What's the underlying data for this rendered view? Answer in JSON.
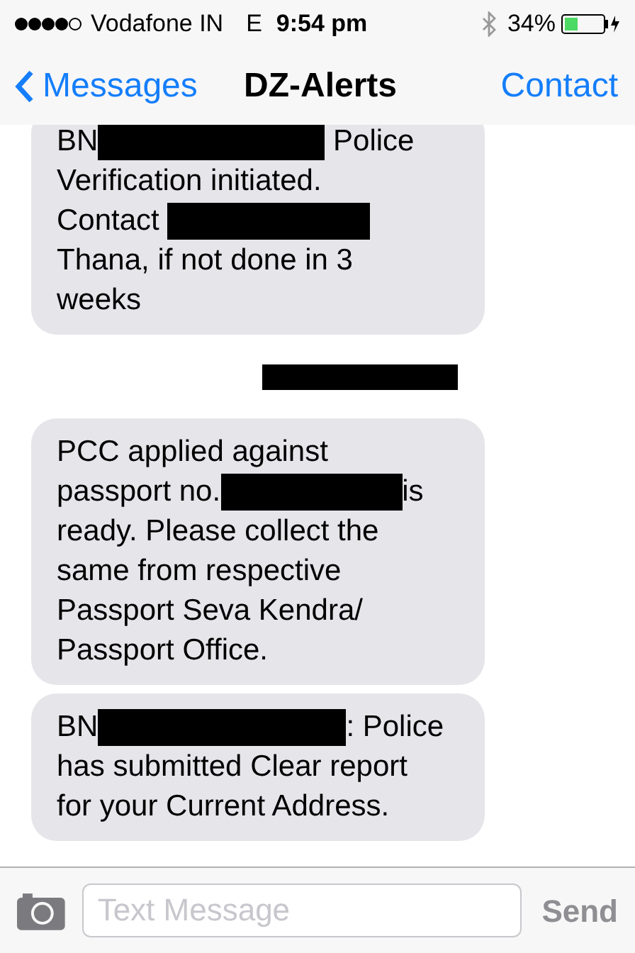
{
  "status_bar": {
    "carrier": "Vodafone IN",
    "network": "E",
    "time": "9:54 pm",
    "battery": "34%"
  },
  "nav": {
    "back": "Messages",
    "title": "DZ-Alerts",
    "action": "Contact"
  },
  "items": [
    {
      "kind": "bubble",
      "lines": [
        [
          {
            "kind": "text",
            "text": "BN"
          },
          {
            "kind": "redaction"
          },
          {
            "kind": "text",
            "text": " Police"
          }
        ],
        [
          {
            "kind": "text",
            "text": "Verification initiated."
          }
        ],
        [
          {
            "kind": "text",
            "text": "Contact "
          },
          {
            "kind": "redaction"
          }
        ],
        [
          {
            "kind": "text",
            "text": "Thana, if not done in 3"
          }
        ],
        [
          {
            "kind": "text",
            "text": "weeks"
          }
        ]
      ]
    },
    {
      "kind": "timestamp"
    },
    {
      "kind": "bubble",
      "lines": [
        [
          {
            "kind": "text",
            "text": "PCC applied against"
          }
        ],
        [
          {
            "kind": "text",
            "text": "passport no."
          },
          {
            "kind": "redaction"
          },
          {
            "kind": "text",
            "text": "is"
          }
        ],
        [
          {
            "kind": "text",
            "text": "ready. Please collect the"
          }
        ],
        [
          {
            "kind": "text",
            "text": "same from respective"
          }
        ],
        [
          {
            "kind": "text",
            "text": "Passport Seva Kendra/"
          }
        ],
        [
          {
            "kind": "text",
            "text": "Passport Office."
          }
        ]
      ]
    },
    {
      "kind": "bubble",
      "lines": [
        [
          {
            "kind": "text",
            "text": "BN"
          },
          {
            "kind": "redaction"
          },
          {
            "kind": "text",
            "text": ": Police"
          }
        ],
        [
          {
            "kind": "text",
            "text": "has submitted Clear report"
          }
        ],
        [
          {
            "kind": "text",
            "text": "for your Current Address."
          }
        ]
      ]
    }
  ],
  "composer": {
    "placeholder": "Text Message",
    "send": "Send"
  }
}
